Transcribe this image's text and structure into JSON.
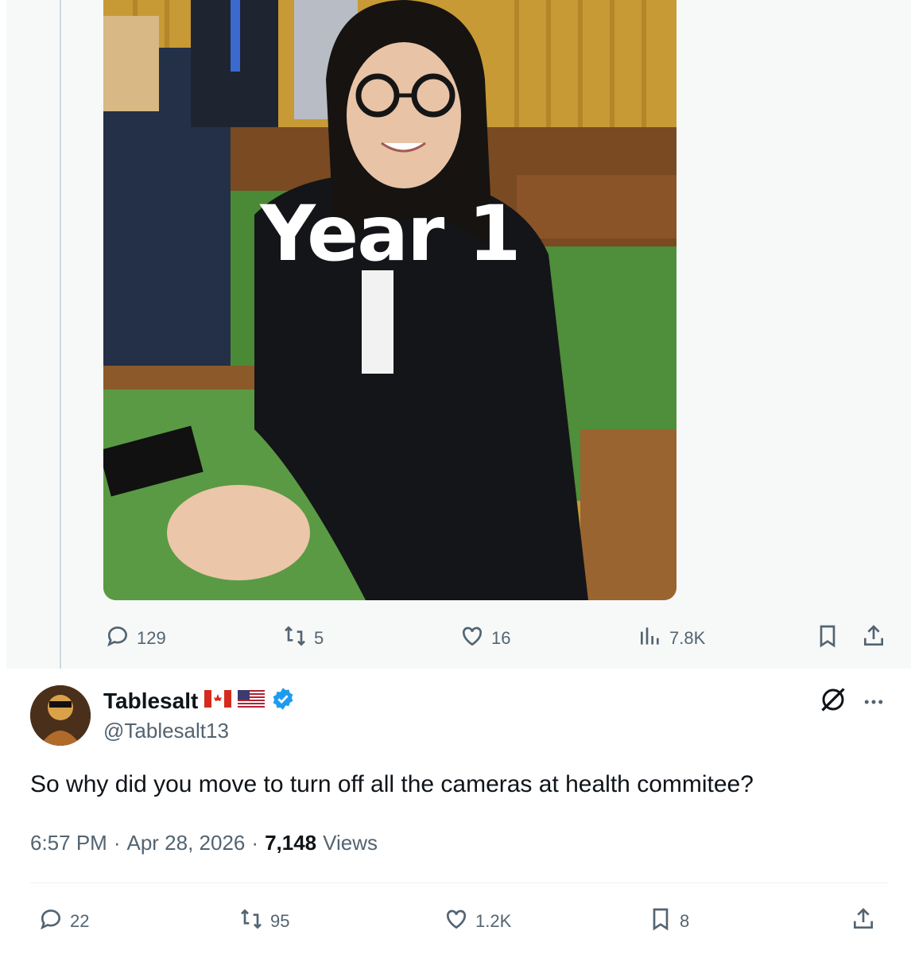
{
  "quoted_tweet": {
    "image_overlay_text": "Year 1",
    "actions": {
      "replies": "129",
      "reposts": "5",
      "likes": "16",
      "views": "7.8K"
    }
  },
  "reply_tweet": {
    "display_name": "Tablesalt",
    "handle": "@Tablesalt13",
    "text": "So why did you move to turn off all the cameras at health commitee?",
    "time": "6:57 PM",
    "date": "Apr 28, 2026",
    "views_count": "7,148",
    "views_label": "Views",
    "separator": "·",
    "actions": {
      "replies": "22",
      "reposts": "95",
      "likes": "1.2K",
      "bookmarks": "8"
    }
  },
  "colors": {
    "verified": "#1d9bf0",
    "muted_text": "#536471",
    "text": "#0f1419"
  }
}
